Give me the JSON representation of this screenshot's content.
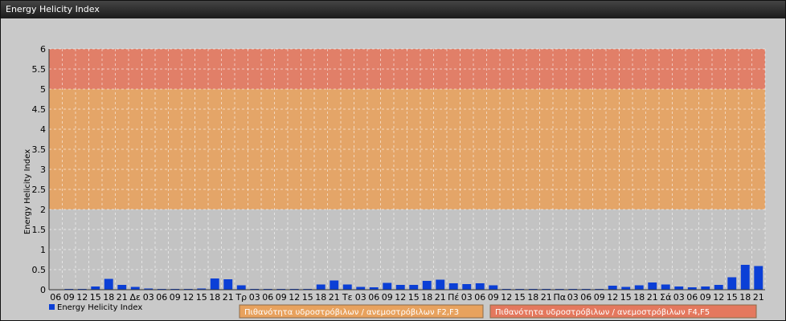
{
  "window": {
    "title": "Energy Helicity Index"
  },
  "chart_data": {
    "type": "bar",
    "title": "",
    "xlabel": "",
    "ylabel": "Energy Helicity Index",
    "ylim": [
      0,
      6
    ],
    "yticks": [
      "0",
      "0.5",
      "1",
      "1.5",
      "2",
      "2.5",
      "3",
      "3.5",
      "4",
      "4.5",
      "5",
      "5.5",
      "6"
    ],
    "grid": true,
    "legend_position": "bottom-left",
    "categories": [
      "06",
      "09",
      "12",
      "15",
      "18",
      "21",
      "Δε",
      "03",
      "06",
      "09",
      "12",
      "15",
      "18",
      "21",
      "Τρ",
      "03",
      "06",
      "09",
      "12",
      "15",
      "18",
      "21",
      "Τε",
      "03",
      "06",
      "09",
      "12",
      "15",
      "18",
      "21",
      "Πέ",
      "03",
      "06",
      "09",
      "12",
      "15",
      "18",
      "21",
      "Πα",
      "03",
      "06",
      "09",
      "12",
      "15",
      "18",
      "21",
      "Σά",
      "03",
      "06",
      "09",
      "12",
      "15",
      "18",
      "21"
    ],
    "series": [
      {
        "name": "Energy Helicity Index",
        "color": "#0b3fd6",
        "values": [
          0.01,
          0.02,
          0.02,
          0.08,
          0.27,
          0.12,
          0.07,
          0.03,
          0.02,
          0.02,
          0.02,
          0.03,
          0.28,
          0.26,
          0.11,
          0.02,
          0.02,
          0.02,
          0.02,
          0.02,
          0.13,
          0.23,
          0.13,
          0.07,
          0.06,
          0.17,
          0.12,
          0.12,
          0.22,
          0.25,
          0.16,
          0.14,
          0.16,
          0.11,
          0.02,
          0.02,
          0.02,
          0.02,
          0.02,
          0.02,
          0.02,
          0.02,
          0.1,
          0.07,
          0.11,
          0.18,
          0.13,
          0.08,
          0.06,
          0.08,
          0.12,
          0.31,
          0.62,
          0.59
        ]
      }
    ],
    "bands": [
      {
        "from": 2,
        "to": 5,
        "color": "#e8a25e",
        "label": "Πιθανότητα υδροστρόβιλων / ανεμοστρόβιλων F2,F3"
      },
      {
        "from": 5,
        "to": 6,
        "color": "#e4785e",
        "label": "Πιθανότητα υδροστρόβιλων / ανεμοστρόβιλων F4,F5"
      }
    ],
    "plot_background": "#c3c3c3"
  }
}
